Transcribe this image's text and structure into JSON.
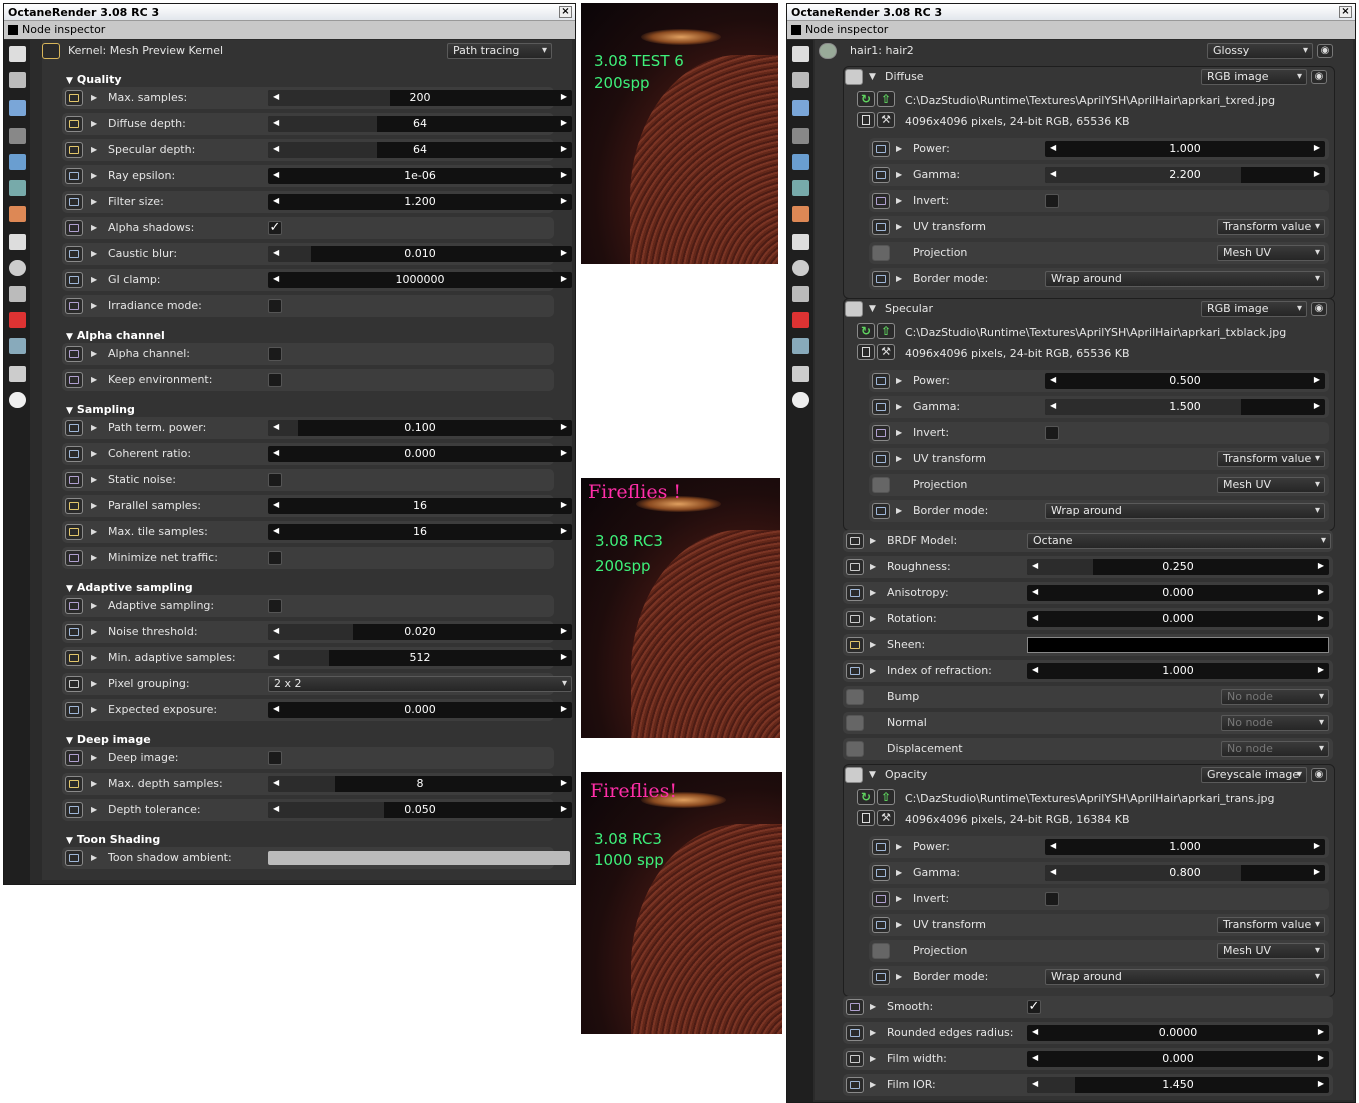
{
  "left": {
    "title": "OctaneRender 3.08 RC 3",
    "close": "×",
    "inspector": "Node inspector",
    "kernel": {
      "label": "Kernel: Mesh Preview Kernel",
      "mode": "Path tracing"
    },
    "sections": {
      "quality": "Quality",
      "alpha": "Alpha channel",
      "sampling": "Sampling",
      "adaptive": "Adaptive sampling",
      "deep": "Deep image",
      "toon": "Toon Shading"
    },
    "rows": [
      {
        "label": "Max. samples:",
        "value": "200",
        "fill": 0.4
      },
      {
        "label": "Diffuse depth:",
        "value": "64",
        "fill": 0.36
      },
      {
        "label": "Specular depth:",
        "value": "64",
        "fill": 0.36
      },
      {
        "label": "Ray epsilon:",
        "value": "1e-06",
        "fill": 0
      },
      {
        "label": "Filter size:",
        "value": "1.200",
        "fill": 0
      },
      {
        "label": "Alpha shadows:",
        "value": "✓"
      },
      {
        "label": "Caustic blur:",
        "value": "0.010",
        "fill": 0.14
      },
      {
        "label": "GI clamp:",
        "value": "1000000",
        "fill": 0
      },
      {
        "label": "Irradiance mode:",
        "value": ""
      },
      {
        "label": "Alpha channel:",
        "value": ""
      },
      {
        "label": "Keep environment:",
        "value": ""
      },
      {
        "label": "Path term. power:",
        "value": "0.100",
        "fill": 0.1
      },
      {
        "label": "Coherent ratio:",
        "value": "0.000",
        "fill": 0
      },
      {
        "label": "Static noise:",
        "value": ""
      },
      {
        "label": "Parallel samples:",
        "value": "16",
        "fill": 0
      },
      {
        "label": "Max. tile samples:",
        "value": "16",
        "fill": 0
      },
      {
        "label": "Minimize net traffic:",
        "value": ""
      },
      {
        "label": "Adaptive sampling:",
        "value": ""
      },
      {
        "label": "Noise threshold:",
        "value": "0.020",
        "fill": 0.28
      },
      {
        "label": "Min. adaptive samples:",
        "value": "512",
        "fill": 0.2
      },
      {
        "label": "Pixel grouping:",
        "value": "2 x 2"
      },
      {
        "label": "Expected exposure:",
        "value": "0.000",
        "fill": 0
      },
      {
        "label": "Deep image:",
        "value": ""
      },
      {
        "label": "Max. depth samples:",
        "value": "8",
        "fill": 0.22
      },
      {
        "label": "Depth tolerance:",
        "value": "0.050",
        "fill": 0.38
      },
      {
        "label": "Toon shadow ambient:",
        "value": ""
      }
    ]
  },
  "middle": {
    "img1": {
      "line1": "3.08 TEST 6",
      "line2": "200spp"
    },
    "img2": {
      "warn": "Fireflies !",
      "line1": "3.08 RC3",
      "line2": "200spp"
    },
    "img3": {
      "warn": "Fireflies!",
      "line1": "3.08 RC3",
      "line2": "1000 spp"
    }
  },
  "right": {
    "title": "OctaneRender 3.08 RC 3",
    "close": "×",
    "inspector": "Node inspector",
    "node": {
      "label": "hair1: hair2",
      "type": "Glossy"
    },
    "groups": {
      "diffuse": {
        "name": "Diffuse",
        "type": "RGB image",
        "path": "C:\\DazStudio\\Runtime\\Textures\\AprilYSH\\AprilHair\\aprkari_txred.jpg",
        "info": "4096x4096 pixels, 24-bit RGB, 65536 KB",
        "power": "1.000",
        "gamma": "2.200",
        "invert": "",
        "uv": "Transform value",
        "proj": "Mesh UV",
        "border": "Wrap around"
      },
      "specular": {
        "name": "Specular",
        "type": "RGB image",
        "path": "C:\\DazStudio\\Runtime\\Textures\\AprilYSH\\AprilHair\\aprkari_txblack.jpg",
        "info": "4096x4096 pixels, 24-bit RGB, 65536 KB",
        "power": "0.500",
        "gamma": "1.500",
        "invert": "",
        "uv": "Transform value",
        "proj": "Mesh UV",
        "border": "Wrap around"
      },
      "opacity": {
        "name": "Opacity",
        "type": "Greyscale image",
        "path": "C:\\DazStudio\\Runtime\\Textures\\AprilYSH\\AprilHair\\aprkari_trans.jpg",
        "info": "4096x4096 pixels, 24-bit RGB, 16384 KB",
        "power": "1.000",
        "gamma": "0.800",
        "invert": "",
        "uv": "Transform value",
        "proj": "Mesh UV",
        "border": "Wrap around"
      }
    },
    "labels": {
      "power": "Power:",
      "gamma": "Gamma:",
      "invert": "Invert:",
      "uv": "UV transform",
      "proj": "Projection",
      "border": "Border mode:"
    },
    "brdf": {
      "label": "BRDF Model:",
      "value": "Octane"
    },
    "mid": [
      {
        "label": "Roughness:",
        "value": "0.250",
        "fill": 0.22
      },
      {
        "label": "Anisotropy:",
        "value": "0.000",
        "fill": 0
      },
      {
        "label": "Rotation:",
        "value": "0.000",
        "fill": 0
      }
    ],
    "sheen": "Sheen:",
    "ior": {
      "label": "Index of refraction:",
      "value": "1.000"
    },
    "nonode": [
      {
        "label": "Bump",
        "value": "No node"
      },
      {
        "label": "Normal",
        "value": "No node"
      },
      {
        "label": "Displacement",
        "value": "No node"
      }
    ],
    "bottom": [
      {
        "label": "Smooth:",
        "value": "✓"
      },
      {
        "label": "Rounded edges radius:",
        "value": "0.0000",
        "fill": 0
      },
      {
        "label": "Film width:",
        "value": "0.000",
        "fill": 0
      },
      {
        "label": "Film IOR:",
        "value": "1.450",
        "fill": 0.16
      }
    ]
  }
}
